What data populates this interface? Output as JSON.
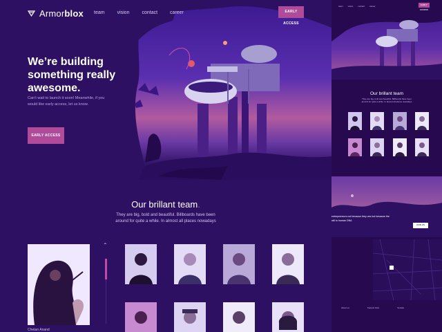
{
  "brand": {
    "name_light": "Armor",
    "name_bold": "blox"
  },
  "nav": [
    "team",
    "vision",
    "contact",
    "career"
  ],
  "header": {
    "cta_label": "EARLY ACCESS"
  },
  "hero": {
    "headline_line1": "We’re building",
    "headline_line2": "something really",
    "headline_line3": "awesome.",
    "subline": "Can’t wait to launch it soon! Meanwhile, if you would like early access, let us know.",
    "cta_label": "EARLY ACCESS"
  },
  "team": {
    "title": "Our brillant team",
    "title_dot": ".",
    "description": "They are big, bold and beautiful. Billboards have been around for quite a while. In almost all places nowadays",
    "featured_name": "Chetan Anand",
    "portrait_count": 8
  },
  "side_preview": {
    "nav": [
      "team",
      "vision",
      "contact",
      "career"
    ],
    "cta_label": "EARLY ACCESS",
    "title": "Our brillant team",
    "description": "They are big, bold and beautiful. Billboards have been around for quite a while. In almost all places nowadays",
    "quote": "entrepreneurs not because they ves but because the will to human DNA",
    "quote_cta": "JOIN US",
    "footer_cols": [
      "About us",
      "Support links",
      "Socials"
    ]
  },
  "colors": {
    "background": "#2d1062",
    "accent": "#b04a9a",
    "text_muted": "#b8a6e8"
  }
}
